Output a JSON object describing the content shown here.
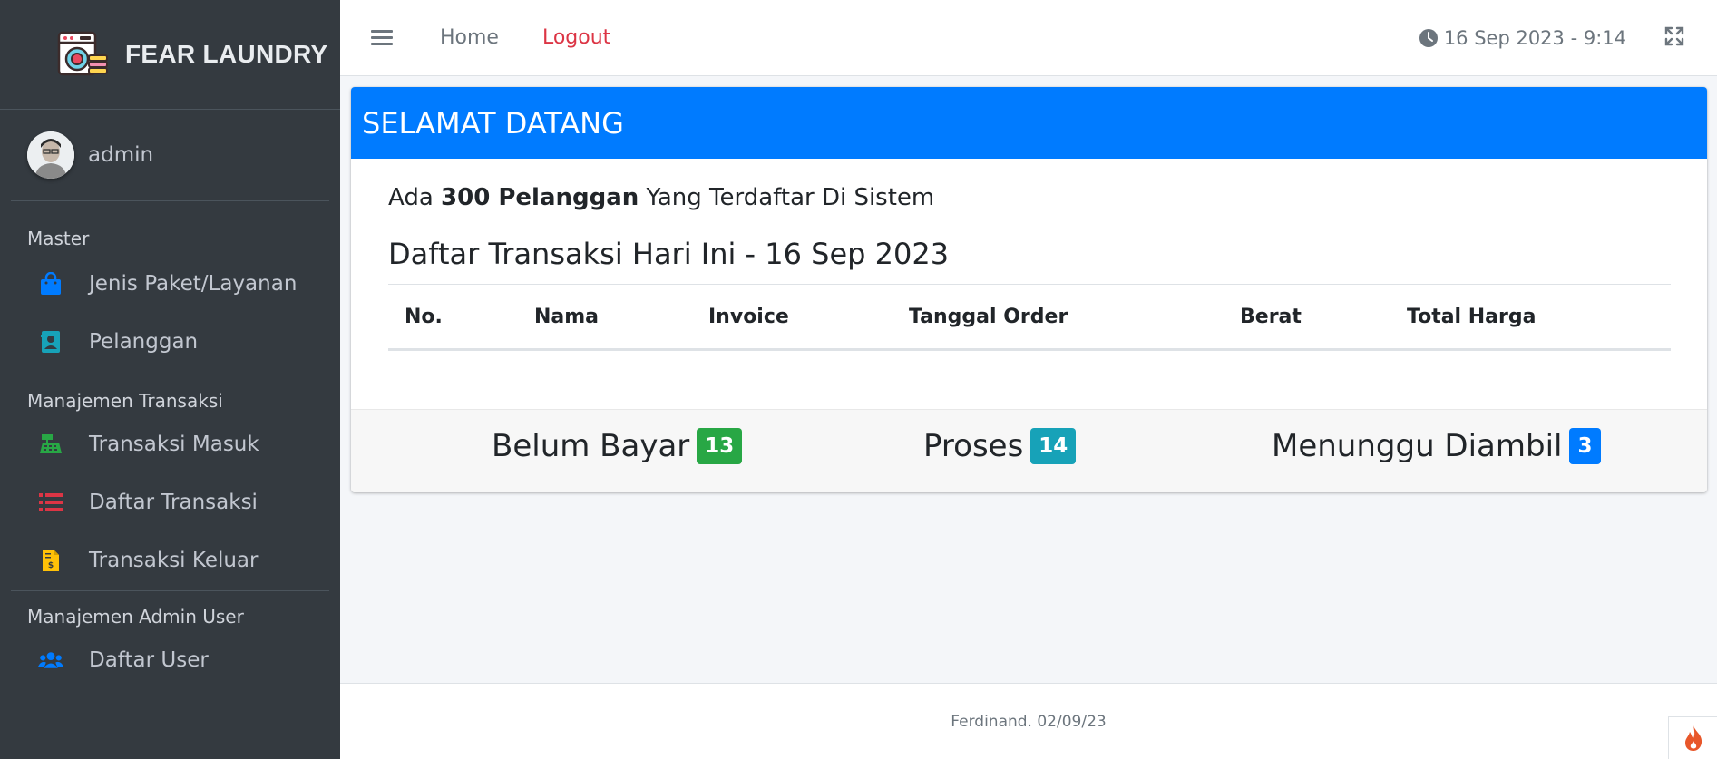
{
  "brand": {
    "name": "FEAR LAUNDRY",
    "logo_icon": "washing-machine-icon"
  },
  "user": {
    "name": "admin"
  },
  "sidebar": {
    "sections": [
      {
        "header": "Master"
      },
      {
        "header": "Manajemen Transaksi"
      },
      {
        "header": "Manajemen Admin User"
      }
    ],
    "items": [
      {
        "label": "Jenis Paket/Layanan",
        "icon": "shopping-bag-icon",
        "color": "#007bff"
      },
      {
        "label": "Pelanggan",
        "icon": "address-book-icon",
        "color": "#17a2b8"
      },
      {
        "label": "Transaksi Masuk",
        "icon": "cash-register-icon",
        "color": "#28a745"
      },
      {
        "label": "Daftar Transaksi",
        "icon": "list-icon",
        "color": "#dc3545"
      },
      {
        "label": "Transaksi Keluar",
        "icon": "invoice-dollar-icon",
        "color": "#ffc107"
      },
      {
        "label": "Daftar User",
        "icon": "users-icon",
        "color": "#007bff"
      }
    ]
  },
  "navbar": {
    "home": "Home",
    "logout": "Logout",
    "datetime": "16 Sep 2023 - 9:14"
  },
  "card": {
    "header": "SELAMAT DATANG",
    "lead_prefix": "Ada ",
    "lead_count": "300 Pelanggan",
    "lead_suffix": " Yang Terdaftar Di Sistem",
    "subtitle": "Daftar Transaksi Hari Ini - 16 Sep 2023",
    "table_headers": [
      "No.",
      "Nama",
      "Invoice",
      "Tanggal Order",
      "Berat",
      "Total Harga"
    ],
    "rows": []
  },
  "stats": [
    {
      "label": "Belum Bayar",
      "value": "13",
      "color": "#28a745"
    },
    {
      "label": "Proses",
      "value": "14",
      "color": "#17a2b8"
    },
    {
      "label": "Menunggu Diambil",
      "value": "3",
      "color": "#007bff"
    }
  ],
  "footer": {
    "text": "Ferdinand. 02/09/23"
  },
  "colors": {
    "primary": "#007bff",
    "sidebar": "#343a40",
    "logout": "#dc3545"
  }
}
